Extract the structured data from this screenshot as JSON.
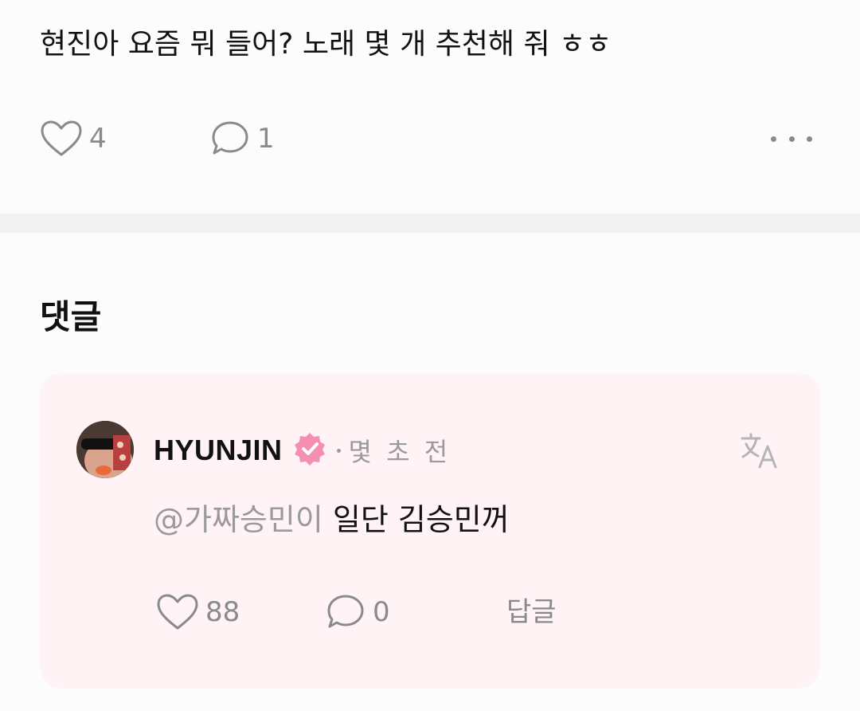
{
  "post": {
    "text": "현진아 요즘 뭐 들어? 노래 몇 개 추천해 줘 ㅎㅎ",
    "like_count": "4",
    "comment_count": "1",
    "like_icon": "heart-outline-icon",
    "comment_icon": "speech-bubble-icon",
    "more_icon": "more-horizontal-icon"
  },
  "comments_section": {
    "title": "댓글"
  },
  "comment": {
    "author": "HYUNJIN",
    "verified_icon": "verified-badge-icon",
    "badge_color": "#f48fb1",
    "time": "몇 초 전",
    "translate_icon": "translate-icon",
    "mention": "@가짜승민이",
    "text": " 일단 김승민꺼",
    "like_count": "88",
    "reply_count": "0",
    "reply_label": "답글",
    "card_color": "#fff3f6"
  }
}
